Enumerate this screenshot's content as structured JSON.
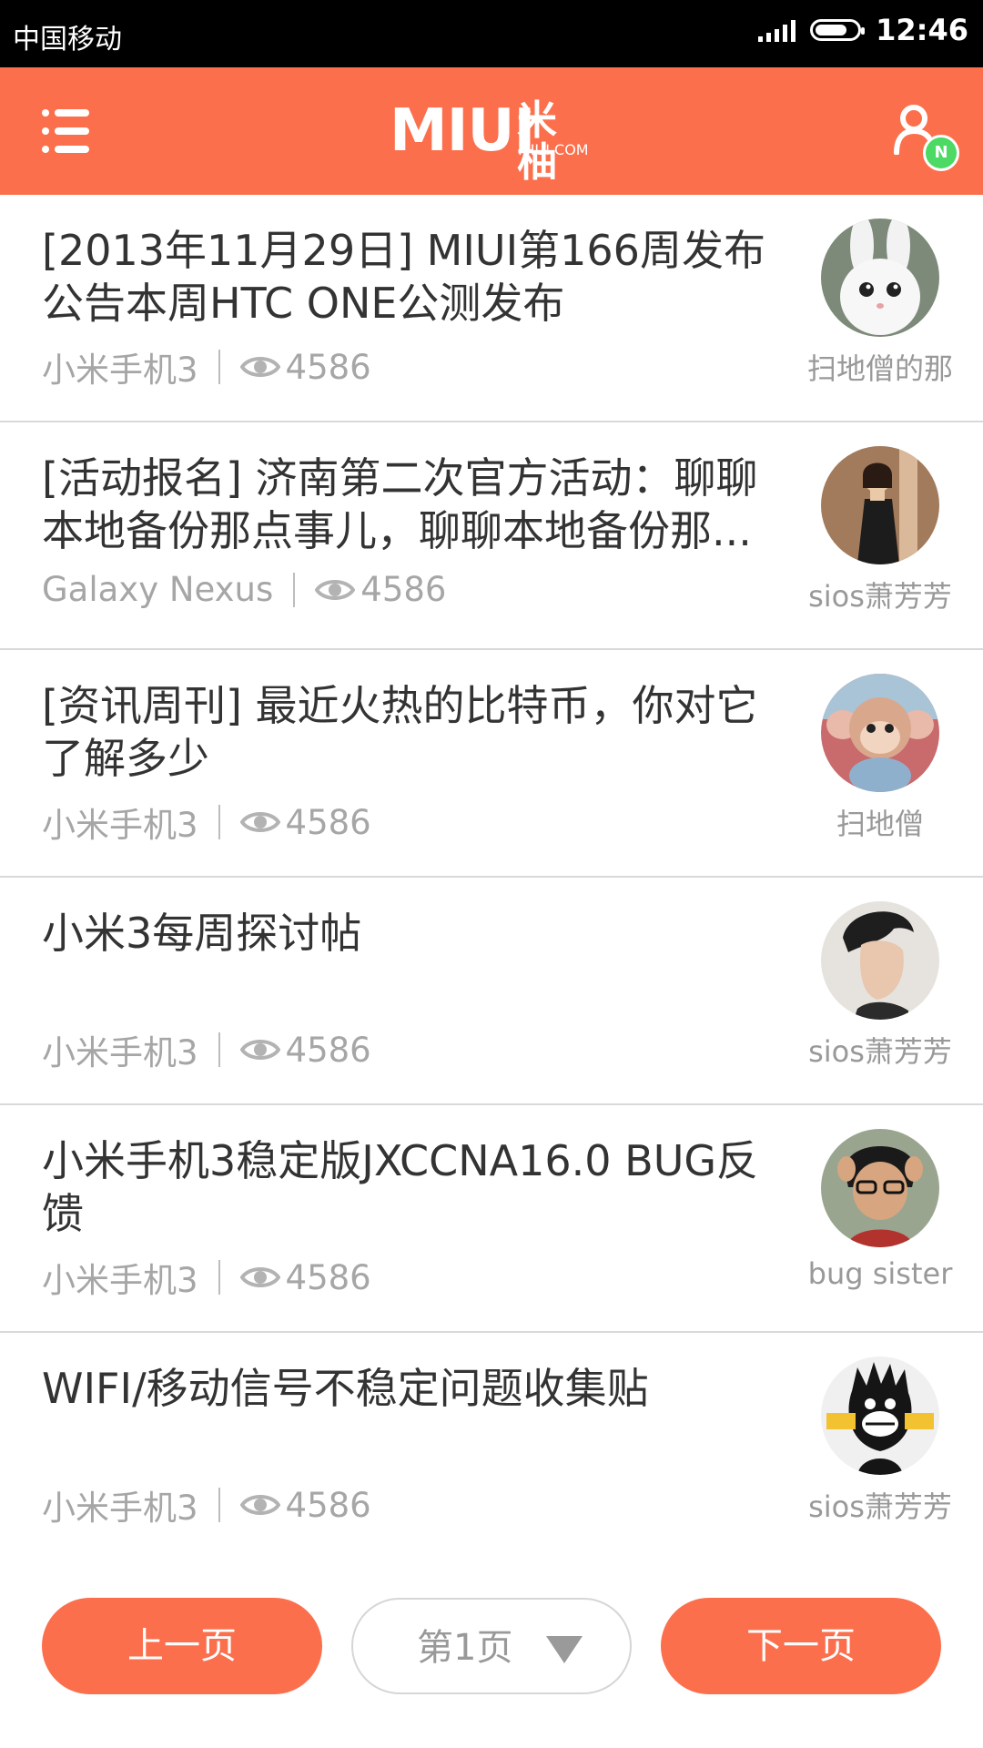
{
  "status_bar": {
    "carrier": "中国移动",
    "time": "12:46"
  },
  "header": {
    "logo_text": "MIUI",
    "logo_cn": "米柚",
    "logo_sub": "MIUI.COM",
    "notification_badge": "N",
    "accent_color": "#fc6f4d"
  },
  "posts": [
    {
      "title": "[2013年11月29日] MIUI第166周发布公告本周HTC ONE公测发布",
      "device": "小米手机3",
      "views": "4586",
      "author": "扫地僧的那"
    },
    {
      "title": "[活动报名] 济南第二次官方活动：聊聊本地备份那点事儿，聊聊本地备份那...",
      "device": "Galaxy Nexus",
      "views": "4586",
      "author": "sios萧芳芳"
    },
    {
      "title": "[资讯周刊] 最近火热的比特币，你对它了解多少",
      "device": "小米手机3",
      "views": "4586",
      "author": "扫地僧"
    },
    {
      "title": "小米3每周探讨帖",
      "device": "小米手机3",
      "views": "4586",
      "author": "sios萧芳芳"
    },
    {
      "title": "小米手机3稳定版JXCCNA16.0 BUG反馈",
      "device": "小米手机3",
      "views": "4586",
      "author": "bug sister"
    },
    {
      "title": "WIFI/移动信号不稳定问题收集贴",
      "device": "小米手机3",
      "views": "4586",
      "author": "sios萧芳芳"
    }
  ],
  "pagination": {
    "prev_label": "上一页",
    "current_label": "第1页",
    "next_label": "下一页"
  }
}
